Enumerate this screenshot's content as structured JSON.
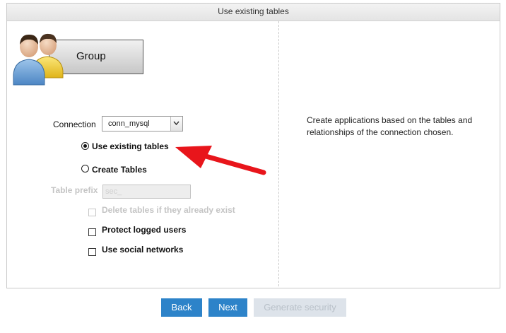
{
  "panel": {
    "title": "Use existing tables"
  },
  "group": {
    "label": "Group"
  },
  "connection": {
    "label": "Connection",
    "value": "conn_mysql"
  },
  "options": {
    "use_existing": "Use existing tables",
    "create_tables": "Create Tables",
    "selected": "use_existing"
  },
  "table_prefix": {
    "label": "Table prefix",
    "value": "sec_"
  },
  "checkboxes": {
    "delete_tables": "Delete tables if they already exist",
    "protect_logged": "Protect logged users",
    "social_networks": "Use social networks"
  },
  "description": "Create applications based on the tables and relationships of the connection chosen.",
  "buttons": {
    "back": "Back",
    "next": "Next",
    "generate": "Generate security"
  },
  "colors": {
    "primary_button": "#2d83c9",
    "arrow": "#e8151b"
  }
}
